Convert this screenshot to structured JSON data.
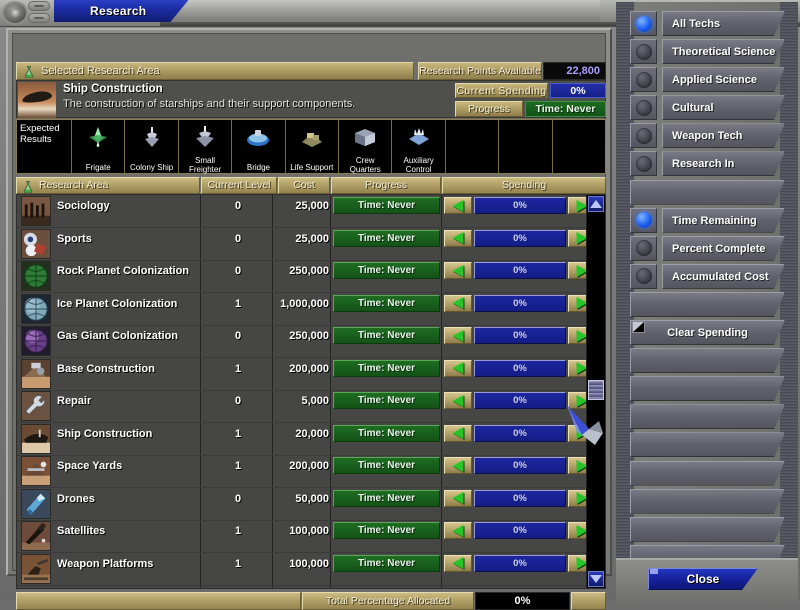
{
  "window": {
    "tab_title": "Research"
  },
  "header": {
    "selected_area_label": "Selected Research Area",
    "research_points_label": "Research Points Available",
    "research_points_value": "22,800"
  },
  "selected": {
    "title": "Ship Construction",
    "description": "The construction of starships and their support components.",
    "current_spending_label": "Current Spending",
    "current_spending_value": "0%",
    "progress_label": "Progress",
    "progress_value": "Time: Never"
  },
  "expected_results": {
    "label": "Expected\nResults",
    "label_line1": "Expected",
    "label_line2": "Results",
    "items": [
      {
        "name": "Frigate",
        "icon": "frigate-icon"
      },
      {
        "name": "Colony Ship",
        "icon": "colony-ship-icon"
      },
      {
        "name": "Small Freighter",
        "icon": "small-freighter-icon",
        "line1": "Small",
        "line2": "Freighter"
      },
      {
        "name": "Bridge",
        "icon": "bridge-icon"
      },
      {
        "name": "Life Support",
        "icon": "life-support-icon"
      },
      {
        "name": "Crew Quarters",
        "icon": "crew-quarters-icon",
        "line1": "Crew",
        "line2": "Quarters"
      },
      {
        "name": "Auxiliary Control",
        "icon": "auxiliary-control-icon",
        "line1": "Auxiliary",
        "line2": "Control"
      },
      {
        "name": "",
        "icon": ""
      },
      {
        "name": "",
        "icon": ""
      },
      {
        "name": "",
        "icon": ""
      }
    ]
  },
  "table": {
    "columns": [
      "Research Area",
      "Current Level",
      "Cost",
      "Progress",
      "Spending"
    ],
    "rows": [
      {
        "name": "Sociology",
        "level": "0",
        "cost": "25,000",
        "progress": "Time: Never",
        "spending": "0%",
        "icon": "sociology-icon"
      },
      {
        "name": "Sports",
        "level": "0",
        "cost": "25,000",
        "progress": "Time: Never",
        "spending": "0%",
        "icon": "sports-icon"
      },
      {
        "name": "Rock Planet Colonization",
        "level": "0",
        "cost": "250,000",
        "progress": "Time: Never",
        "spending": "0%",
        "icon": "rock-planet-icon"
      },
      {
        "name": "Ice Planet Colonization",
        "level": "1",
        "cost": "1,000,000",
        "progress": "Time: Never",
        "spending": "0%",
        "icon": "ice-planet-icon"
      },
      {
        "name": "Gas Giant Colonization",
        "level": "0",
        "cost": "250,000",
        "progress": "Time: Never",
        "spending": "0%",
        "icon": "gas-giant-icon"
      },
      {
        "name": "Base Construction",
        "level": "1",
        "cost": "200,000",
        "progress": "Time: Never",
        "spending": "0%",
        "icon": "base-construction-icon"
      },
      {
        "name": "Repair",
        "level": "0",
        "cost": "5,000",
        "progress": "Time: Never",
        "spending": "0%",
        "icon": "repair-icon"
      },
      {
        "name": "Ship Construction",
        "level": "1",
        "cost": "20,000",
        "progress": "Time: Never",
        "spending": "0%",
        "icon": "ship-construction-icon"
      },
      {
        "name": "Space Yards",
        "level": "1",
        "cost": "200,000",
        "progress": "Time: Never",
        "spending": "0%",
        "icon": "space-yards-icon"
      },
      {
        "name": "Drones",
        "level": "0",
        "cost": "50,000",
        "progress": "Time: Never",
        "spending": "0%",
        "icon": "drones-icon"
      },
      {
        "name": "Satellites",
        "level": "1",
        "cost": "100,000",
        "progress": "Time: Never",
        "spending": "0%",
        "icon": "satellites-icon"
      },
      {
        "name": "Weapon Platforms",
        "level": "1",
        "cost": "100,000",
        "progress": "Time: Never",
        "spending": "0%",
        "icon": "weapon-platforms-icon"
      }
    ]
  },
  "footer": {
    "total_label": "Total Percentage Allocated",
    "total_value": "0%"
  },
  "sidebar": {
    "filters": [
      {
        "label": "All Techs",
        "selected": true
      },
      {
        "label": "Theoretical Science",
        "selected": false
      },
      {
        "label": "Applied Science",
        "selected": false
      },
      {
        "label": "Cultural Advancement",
        "selected": false
      },
      {
        "label": "Weapon Tech",
        "selected": false
      },
      {
        "label": "Research In Progress",
        "selected": false
      }
    ],
    "displays": [
      {
        "label": "Time Remaining",
        "selected": true
      },
      {
        "label": "Percent Complete",
        "selected": false
      },
      {
        "label": "Accumulated Cost",
        "selected": false
      }
    ],
    "actions": [
      {
        "label": "Clear Spending"
      }
    ],
    "close_label": "Close"
  },
  "colors": {
    "gold": "#b4a369",
    "blue_tab": "#1b2aa0",
    "progress_green": "#1a6320",
    "spending_blue": "#161f8c",
    "points_text": "#a9a0ff"
  }
}
